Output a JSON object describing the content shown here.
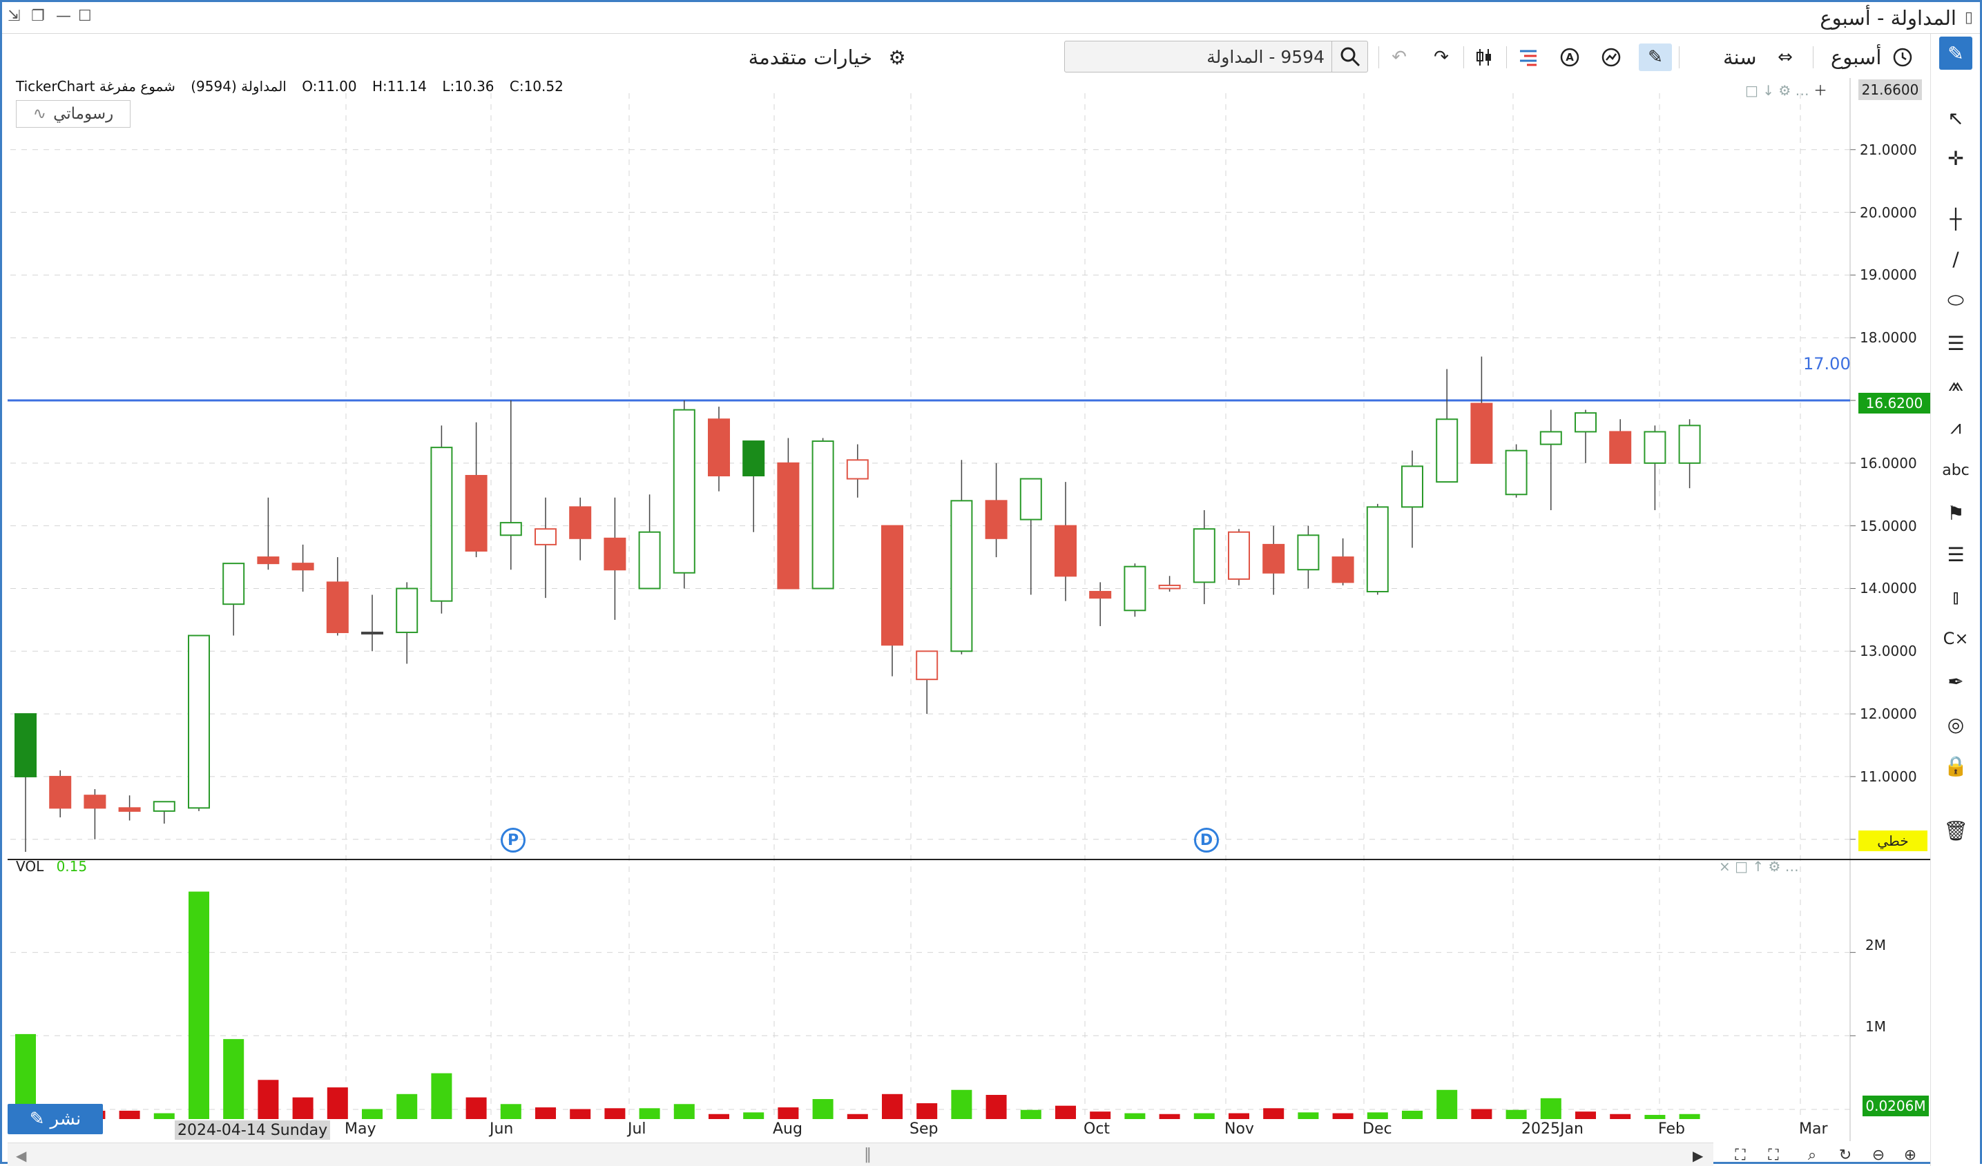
{
  "window": {
    "title": "المداولة - أسبوع"
  },
  "toolbar": {
    "period_label": "أسبوع",
    "range_label": "سنة",
    "search_value": "9594 - المداولة",
    "advanced_options": "خيارات متقدمة"
  },
  "header": {
    "chart_title": "TickerChart المداولة (9594)",
    "chart_style": "شموع مفرغة",
    "open": "O:11.00",
    "high": "H:11.14",
    "low": "L:10.36",
    "close": "C:10.52",
    "drawings_button": "رسوماتي"
  },
  "price_axis": {
    "labels": [
      "21.0000",
      "20.0000",
      "19.0000",
      "18.0000",
      "17.0000",
      "16.0000",
      "15.0000",
      "14.0000",
      "13.0000",
      "12.0000",
      "11.0000",
      "10.0000"
    ],
    "top_badge": "21.6600",
    "last_price_badge": "16.6200",
    "hline_label": "17.00",
    "scale_mode_badge": "خطي"
  },
  "volume": {
    "title": "VOL",
    "value": "0.15",
    "axis_labels": [
      "2M",
      "1M"
    ],
    "last_badge": "0.0206M"
  },
  "markers": [
    "P",
    "D"
  ],
  "x_axis": {
    "labels": [
      "May",
      "Jun",
      "Jul",
      "Aug",
      "Sep",
      "Oct",
      "Nov",
      "Dec",
      "2025Jan",
      "Feb",
      "Mar"
    ],
    "cursor_date": "2024-04-14 Sunday",
    "publish_button": "نشر"
  },
  "colors": {
    "up": "#1a8c1a",
    "up_outline": "#2a9a2a",
    "down": "#e05546",
    "vol_up": "#3ed40e",
    "vol_down": "#d80f16",
    "hline": "#3b6fe0",
    "last_badge": "#16a016",
    "top_badge": "#d8d8d8",
    "scale_badge": "#f8f800"
  },
  "chart_data": {
    "type": "candlestick",
    "interval": "weekly",
    "horizontal_line": 17.0,
    "ylim": [
      9.7,
      21.9
    ],
    "candles": [
      {
        "o": 11.0,
        "h": 11.1,
        "l": 9.8,
        "c": 12.0,
        "fill": "solid-up"
      },
      {
        "o": 11.0,
        "h": 11.1,
        "l": 10.35,
        "c": 10.5,
        "fill": "down"
      },
      {
        "o": 10.7,
        "h": 10.8,
        "l": 10.0,
        "c": 10.5,
        "fill": "down"
      },
      {
        "o": 10.5,
        "h": 10.7,
        "l": 10.3,
        "c": 10.45,
        "fill": "down"
      },
      {
        "o": 10.45,
        "h": 10.6,
        "l": 10.25,
        "c": 10.6,
        "fill": "hollow-up"
      },
      {
        "o": 10.5,
        "h": 10.6,
        "l": 10.45,
        "c": 13.25,
        "fill": "hollow-up"
      },
      {
        "o": 13.75,
        "h": 14.2,
        "l": 13.25,
        "c": 14.4,
        "fill": "hollow-up"
      },
      {
        "o": 14.5,
        "h": 15.45,
        "l": 14.3,
        "c": 14.4,
        "fill": "down"
      },
      {
        "o": 14.4,
        "h": 14.7,
        "l": 13.95,
        "c": 14.3,
        "fill": "down"
      },
      {
        "o": 14.1,
        "h": 14.5,
        "l": 13.25,
        "c": 13.3,
        "fill": "down"
      },
      {
        "o": 13.3,
        "h": 13.9,
        "l": 13.0,
        "c": 13.3,
        "fill": "doji"
      },
      {
        "o": 13.3,
        "h": 14.1,
        "l": 12.8,
        "c": 14.0,
        "fill": "hollow-up"
      },
      {
        "o": 13.8,
        "h": 16.6,
        "l": 13.6,
        "c": 16.25,
        "fill": "hollow-up"
      },
      {
        "o": 15.8,
        "h": 16.65,
        "l": 14.5,
        "c": 14.6,
        "fill": "down"
      },
      {
        "o": 14.85,
        "h": 17.0,
        "l": 14.3,
        "c": 15.05,
        "fill": "hollow-up"
      },
      {
        "o": 14.95,
        "h": 15.45,
        "l": 13.85,
        "c": 14.7,
        "fill": "hollow-down"
      },
      {
        "o": 15.3,
        "h": 15.45,
        "l": 14.45,
        "c": 14.8,
        "fill": "down"
      },
      {
        "o": 14.8,
        "h": 15.45,
        "l": 13.5,
        "c": 14.3,
        "fill": "down"
      },
      {
        "o": 14.0,
        "h": 15.5,
        "l": 14.0,
        "c": 14.9,
        "fill": "hollow-up"
      },
      {
        "o": 14.25,
        "h": 17.0,
        "l": 14.0,
        "c": 16.85,
        "fill": "hollow-up"
      },
      {
        "o": 16.7,
        "h": 16.9,
        "l": 15.55,
        "c": 15.8,
        "fill": "down"
      },
      {
        "o": 15.8,
        "h": 16.35,
        "l": 14.9,
        "c": 16.35,
        "fill": "solid-up"
      },
      {
        "o": 16.0,
        "h": 16.4,
        "l": 14.0,
        "c": 14.0,
        "fill": "down"
      },
      {
        "o": 14.0,
        "h": 16.4,
        "l": 14.0,
        "c": 16.35,
        "fill": "hollow-up"
      },
      {
        "o": 16.05,
        "h": 16.3,
        "l": 15.45,
        "c": 15.75,
        "fill": "hollow-down"
      },
      {
        "o": 15.0,
        "h": 15.0,
        "l": 12.6,
        "c": 13.1,
        "fill": "down"
      },
      {
        "o": 13.0,
        "h": 13.0,
        "l": 12.0,
        "c": 12.55,
        "fill": "hollow-down"
      },
      {
        "o": 13.0,
        "h": 16.05,
        "l": 12.95,
        "c": 15.4,
        "fill": "hollow-up"
      },
      {
        "o": 15.4,
        "h": 16.0,
        "l": 14.5,
        "c": 14.8,
        "fill": "down"
      },
      {
        "o": 15.1,
        "h": 15.7,
        "l": 13.9,
        "c": 15.75,
        "fill": "hollow-up"
      },
      {
        "o": 15.0,
        "h": 15.7,
        "l": 13.8,
        "c": 14.2,
        "fill": "down"
      },
      {
        "o": 13.95,
        "h": 14.1,
        "l": 13.4,
        "c": 13.85,
        "fill": "down"
      },
      {
        "o": 13.65,
        "h": 14.4,
        "l": 13.55,
        "c": 14.35,
        "fill": "hollow-up"
      },
      {
        "o": 14.0,
        "h": 14.2,
        "l": 13.95,
        "c": 14.05,
        "fill": "hollow-down"
      },
      {
        "o": 14.1,
        "h": 15.25,
        "l": 13.75,
        "c": 14.95,
        "fill": "hollow-up"
      },
      {
        "o": 14.9,
        "h": 14.95,
        "l": 14.05,
        "c": 14.15,
        "fill": "hollow-down"
      },
      {
        "o": 14.7,
        "h": 15.0,
        "l": 13.9,
        "c": 14.25,
        "fill": "down"
      },
      {
        "o": 14.3,
        "h": 15.0,
        "l": 14.0,
        "c": 14.85,
        "fill": "hollow-up"
      },
      {
        "o": 14.5,
        "h": 14.8,
        "l": 14.05,
        "c": 14.1,
        "fill": "down"
      },
      {
        "o": 13.95,
        "h": 15.35,
        "l": 13.9,
        "c": 15.3,
        "fill": "hollow-up"
      },
      {
        "o": 15.3,
        "h": 16.2,
        "l": 14.65,
        "c": 15.95,
        "fill": "hollow-up"
      },
      {
        "o": 15.7,
        "h": 17.5,
        "l": 15.7,
        "c": 16.7,
        "fill": "hollow-up"
      },
      {
        "o": 16.95,
        "h": 17.7,
        "l": 16.0,
        "c": 16.0,
        "fill": "down"
      },
      {
        "o": 15.5,
        "h": 16.3,
        "l": 15.45,
        "c": 16.2,
        "fill": "hollow-up"
      },
      {
        "o": 16.3,
        "h": 16.85,
        "l": 15.25,
        "c": 16.5,
        "fill": "hollow-up"
      },
      {
        "o": 16.5,
        "h": 16.85,
        "l": 16.0,
        "c": 16.8,
        "fill": "hollow-up"
      },
      {
        "o": 16.5,
        "h": 16.7,
        "l": 16.0,
        "c": 16.0,
        "fill": "down"
      },
      {
        "o": 16.0,
        "h": 16.6,
        "l": 15.25,
        "c": 16.5,
        "fill": "hollow-up"
      },
      {
        "o": 16.0,
        "h": 16.7,
        "l": 15.6,
        "c": 16.6,
        "fill": "hollow-up"
      }
    ],
    "volume": [
      {
        "v": 1.02,
        "dir": "up"
      },
      {
        "v": 0.14,
        "dir": "down"
      },
      {
        "v": 0.1,
        "dir": "down"
      },
      {
        "v": 0.1,
        "dir": "down"
      },
      {
        "v": 0.07,
        "dir": "up"
      },
      {
        "v": 2.73,
        "dir": "up"
      },
      {
        "v": 0.96,
        "dir": "up"
      },
      {
        "v": 0.47,
        "dir": "down"
      },
      {
        "v": 0.26,
        "dir": "down"
      },
      {
        "v": 0.38,
        "dir": "down"
      },
      {
        "v": 0.12,
        "dir": "up"
      },
      {
        "v": 0.3,
        "dir": "up"
      },
      {
        "v": 0.55,
        "dir": "up"
      },
      {
        "v": 0.26,
        "dir": "down"
      },
      {
        "v": 0.18,
        "dir": "up"
      },
      {
        "v": 0.14,
        "dir": "down"
      },
      {
        "v": 0.12,
        "dir": "down"
      },
      {
        "v": 0.13,
        "dir": "down"
      },
      {
        "v": 0.13,
        "dir": "up"
      },
      {
        "v": 0.18,
        "dir": "up"
      },
      {
        "v": 0.06,
        "dir": "down"
      },
      {
        "v": 0.08,
        "dir": "up"
      },
      {
        "v": 0.14,
        "dir": "down"
      },
      {
        "v": 0.24,
        "dir": "up"
      },
      {
        "v": 0.06,
        "dir": "down"
      },
      {
        "v": 0.3,
        "dir": "down"
      },
      {
        "v": 0.19,
        "dir": "down"
      },
      {
        "v": 0.35,
        "dir": "up"
      },
      {
        "v": 0.29,
        "dir": "down"
      },
      {
        "v": 0.11,
        "dir": "up"
      },
      {
        "v": 0.16,
        "dir": "down"
      },
      {
        "v": 0.09,
        "dir": "down"
      },
      {
        "v": 0.07,
        "dir": "up"
      },
      {
        "v": 0.06,
        "dir": "down"
      },
      {
        "v": 0.07,
        "dir": "up"
      },
      {
        "v": 0.07,
        "dir": "down"
      },
      {
        "v": 0.13,
        "dir": "down"
      },
      {
        "v": 0.08,
        "dir": "up"
      },
      {
        "v": 0.07,
        "dir": "down"
      },
      {
        "v": 0.08,
        "dir": "up"
      },
      {
        "v": 0.1,
        "dir": "up"
      },
      {
        "v": 0.35,
        "dir": "up"
      },
      {
        "v": 0.12,
        "dir": "down"
      },
      {
        "v": 0.11,
        "dir": "up"
      },
      {
        "v": 0.25,
        "dir": "up"
      },
      {
        "v": 0.09,
        "dir": "down"
      },
      {
        "v": 0.06,
        "dir": "down"
      },
      {
        "v": 0.05,
        "dir": "up"
      },
      {
        "v": 0.06,
        "dir": "up"
      }
    ],
    "vol_ylim": [
      0,
      2.9
    ]
  }
}
